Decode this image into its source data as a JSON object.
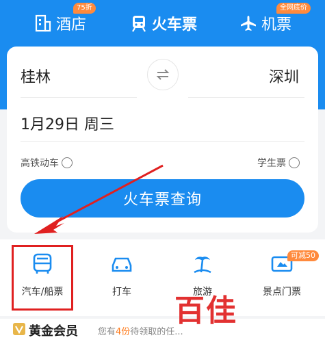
{
  "tabs": [
    {
      "label": "酒店",
      "badge": "75折",
      "icon": "hotel-icon"
    },
    {
      "label": "火车票",
      "badge": "",
      "icon": "train-icon"
    },
    {
      "label": "机票",
      "badge": "全网底价",
      "icon": "plane-icon"
    }
  ],
  "search": {
    "from_city": "桂林",
    "to_city": "深圳",
    "date": "1月29日 周三",
    "option_highspeed": "高铁动车",
    "option_student": "学生票",
    "button_label": "火车票查询"
  },
  "services": [
    {
      "label": "汽车/船票",
      "icon": "bus-icon"
    },
    {
      "label": "打车",
      "icon": "car-icon"
    },
    {
      "label": "旅游",
      "icon": "travel-icon"
    },
    {
      "label": "景点门票",
      "icon": "ticket-icon",
      "badge": "可减50"
    }
  ],
  "member": {
    "title": "黄金会员",
    "text_prefix": "您有",
    "text_count": "4份",
    "text_suffix": "待领取的任..."
  },
  "watermark": "百佳",
  "colors": {
    "primary": "#1a8cf0",
    "badge": "#ff8a3d",
    "highlight": "#e02020"
  }
}
